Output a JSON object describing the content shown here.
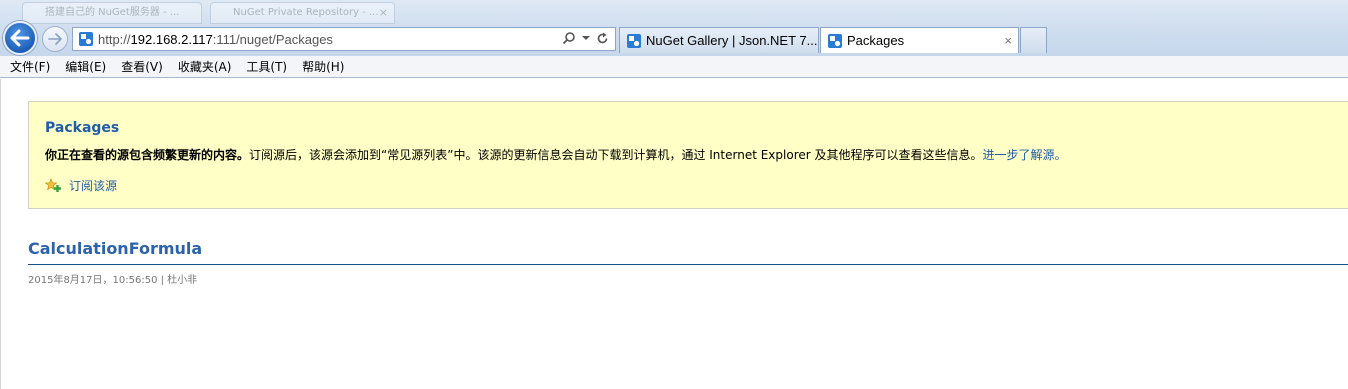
{
  "background_tabs": [
    {
      "label": "搭建自己的 NuGet服务器 - ..."
    },
    {
      "label": "NuGet Private Repository - ..."
    }
  ],
  "address_bar": {
    "url_prefix": "http://",
    "url_host": "192.168.2.117",
    "url_rest": ":111/nuget/Packages"
  },
  "tabs": [
    {
      "label": "NuGet Gallery | Json.NET 7....",
      "active": false
    },
    {
      "label": "Packages",
      "active": true,
      "close": "×"
    }
  ],
  "menu": [
    {
      "label": "文件(F)"
    },
    {
      "label": "编辑(E)"
    },
    {
      "label": "查看(V)"
    },
    {
      "label": "收藏夹(A)"
    },
    {
      "label": "工具(T)"
    },
    {
      "label": "帮助(H)"
    }
  ],
  "feed": {
    "title": "Packages",
    "desc_bold": "你正在查看的源包含频繁更新的内容。",
    "desc_text": "订阅源后，该源会添加到“常见源列表”中。该源的更新信息会自动下载到计算机，通过 Internet Explorer 及其他程序可以查看这些信息。",
    "learn_more": "进一步了解源。",
    "subscribe_label": "订阅该源"
  },
  "item": {
    "title": "CalculationFormula",
    "meta": "2015年8月17日，10:56:50 | 杜小非"
  },
  "colors": {
    "link_blue": "#1f5caa",
    "banner_bg": "#ffffc6",
    "chrome_blue": "#cddcee"
  }
}
